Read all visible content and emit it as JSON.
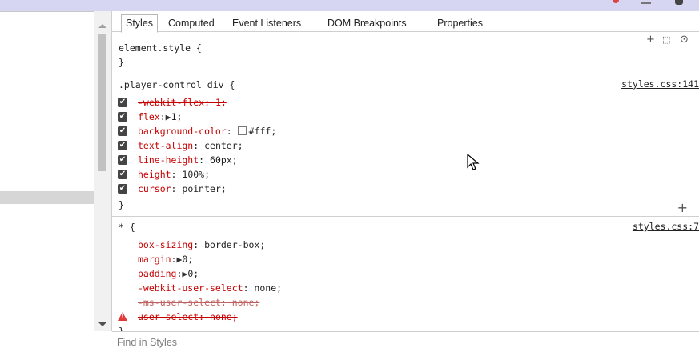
{
  "tabs": [
    "Styles",
    "Computed",
    "Event Listeners",
    "DOM Breakpoints",
    "Properties"
  ],
  "element_style": {
    "open": "element.style {",
    "close": "}"
  },
  "rule1": {
    "selector": ".player-control div {",
    "source": "styles.css:141",
    "props": [
      {
        "name": "-webkit-flex",
        "value": " 1;",
        "sep": ":",
        "checked": true,
        "struck": true
      },
      {
        "name": "flex",
        "value": "1;",
        "sep": ":",
        "triangle": true,
        "checked": true
      },
      {
        "name": "background-color",
        "value": "#fff;",
        "sep": ": ",
        "swatch": true,
        "checked": true
      },
      {
        "name": "text-align",
        "value": "center;",
        "sep": ": ",
        "checked": true
      },
      {
        "name": "line-height",
        "value": "60px;",
        "sep": ": ",
        "checked": true
      },
      {
        "name": "height",
        "value": "100%;",
        "sep": ": ",
        "checked": true
      },
      {
        "name": "cursor",
        "value": "pointer;",
        "sep": ": ",
        "checked": true
      }
    ],
    "close": "}"
  },
  "rule2": {
    "selector": "* {",
    "source": "styles.css:7",
    "props": [
      {
        "name": "box-sizing",
        "value": "border-box;",
        "sep": ": "
      },
      {
        "name": "margin",
        "value": "0;",
        "sep": ":",
        "triangle": true
      },
      {
        "name": "padding",
        "value": "0;",
        "sep": ":",
        "triangle": true
      },
      {
        "name": "-webkit-user-select",
        "value": "none;",
        "sep": ": "
      },
      {
        "name": "-ms-user-select",
        "value": " none;",
        "sep": ":",
        "struck": true,
        "dim": true
      },
      {
        "name": "user-select",
        "value": " none;",
        "sep": ":",
        "struck": true,
        "warning": true
      }
    ],
    "close": "}"
  },
  "find": {
    "placeholder": "Find in Styles"
  },
  "icons": {
    "new_rule": "plus-icon",
    "toggle_state": "element-state-icon",
    "animations": "play-circle-icon",
    "add_property": "plus-icon",
    "warning": "warning-icon"
  }
}
